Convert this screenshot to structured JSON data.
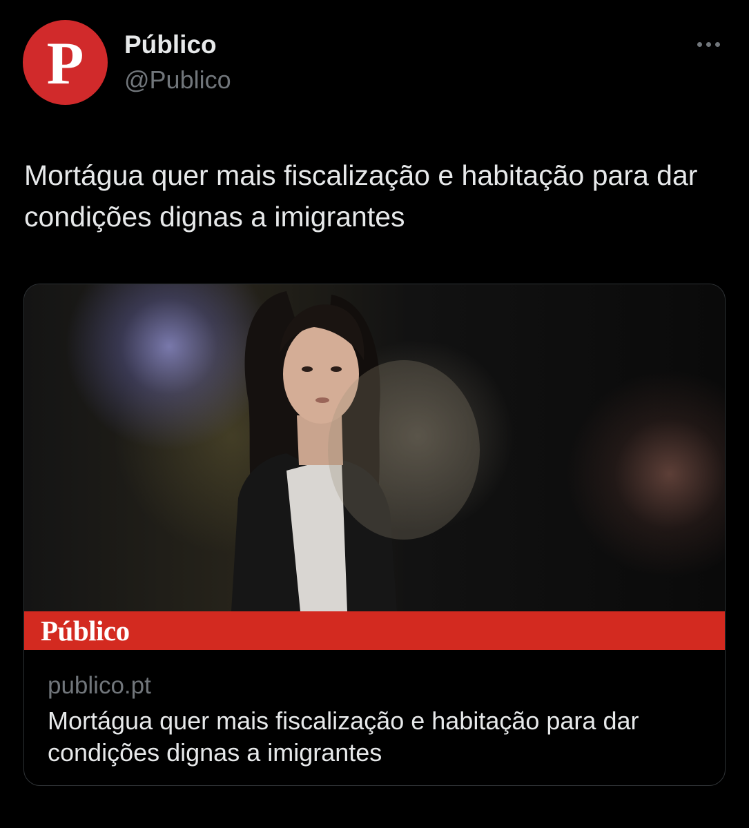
{
  "author": {
    "avatar_letter": "P",
    "display_name": "Público",
    "handle": "@Publico"
  },
  "tweet": {
    "text": "Mortágua quer mais fiscalização e habitação para dar condições dignas a imigrantes"
  },
  "card": {
    "brand_logo_text": "Público",
    "domain": "publico.pt",
    "title": "Mortágua quer mais fiscalização e habitação para dar condições dignas a imigrantes"
  },
  "icons": {
    "more": "more-horizontal-icon"
  },
  "colors": {
    "background": "#000000",
    "avatar": "#d12a2b",
    "brand_bar": "#d32a20",
    "primary_text": "#e7e9ea",
    "secondary_text": "#71767b"
  }
}
